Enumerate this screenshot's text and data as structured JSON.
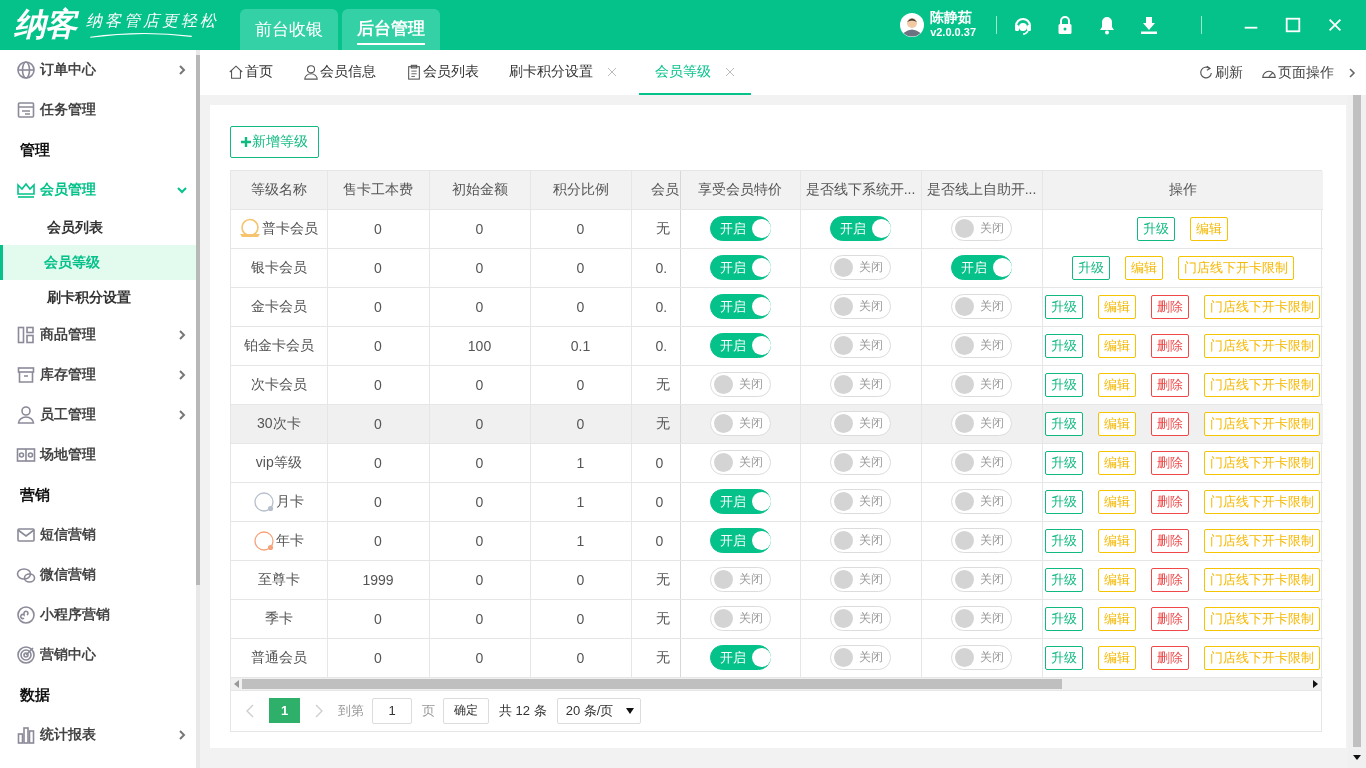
{
  "app": {
    "logo": "纳客",
    "slogan": "纳客管店更轻松",
    "modules": [
      {
        "label": "前台收银",
        "selected": false
      },
      {
        "label": "后台管理",
        "selected": true
      }
    ],
    "user": {
      "name": "陈静茹",
      "version": "v2.0.0.37"
    }
  },
  "sidebar": {
    "items": [
      {
        "kind": "menu",
        "label": "订单中心",
        "expandable": true,
        "expanded": false
      },
      {
        "kind": "menu",
        "label": "任务管理",
        "expandable": false,
        "expanded": false
      },
      {
        "kind": "section",
        "label": "管理"
      },
      {
        "kind": "menu",
        "label": "会员管理",
        "expandable": true,
        "expanded": true,
        "children": [
          {
            "label": "会员列表",
            "selected": false
          },
          {
            "label": "会员等级",
            "selected": true
          },
          {
            "label": "刷卡积分设置",
            "selected": false
          }
        ]
      },
      {
        "kind": "menu",
        "label": "商品管理",
        "expandable": true,
        "expanded": false
      },
      {
        "kind": "menu",
        "label": "库存管理",
        "expandable": true,
        "expanded": false
      },
      {
        "kind": "menu",
        "label": "员工管理",
        "expandable": true,
        "expanded": false
      },
      {
        "kind": "menu",
        "label": "场地管理",
        "expandable": false,
        "expanded": false
      },
      {
        "kind": "section",
        "label": "营销"
      },
      {
        "kind": "menu",
        "label": "短信营销",
        "expandable": false,
        "expanded": false
      },
      {
        "kind": "menu",
        "label": "微信营销",
        "expandable": false,
        "expanded": false
      },
      {
        "kind": "menu",
        "label": "小程序营销",
        "expandable": false,
        "expanded": false
      },
      {
        "kind": "menu",
        "label": "营销中心",
        "expandable": false,
        "expanded": false
      },
      {
        "kind": "section",
        "label": "数据"
      },
      {
        "kind": "menu",
        "label": "统计报表",
        "expandable": true,
        "expanded": false
      }
    ]
  },
  "tabs": [
    {
      "label": "首页",
      "selected": false,
      "closable": false
    },
    {
      "label": "会员信息",
      "selected": false,
      "closable": false
    },
    {
      "label": "会员列表",
      "selected": false,
      "closable": false
    },
    {
      "label": "刷卡积分设置",
      "selected": false,
      "closable": true
    },
    {
      "label": "会员等级",
      "selected": true,
      "closable": true
    }
  ],
  "tab_actions": [
    "刷新",
    "页面操作"
  ],
  "add_button": "新增等级",
  "table": {
    "columns": [
      "等级名称",
      "售卡工本费",
      "初始金额",
      "积分比例",
      "会员",
      "享受会员特价",
      "是否线下系统开...",
      "是否线上自助开...",
      "操作"
    ],
    "rows": [
      {
        "badge": {
          "kind": "medal",
          "color": "#f5c46c"
        },
        "cells": [
          "普卡会员",
          "0",
          "0",
          "0",
          "无"
        ],
        "highlighted": false,
        "toggles": [
          {
            "on": true,
            "label": "开启"
          },
          {
            "on": true,
            "label": "开启"
          },
          {
            "on": false,
            "label": "关闭"
          }
        ],
        "actions": [
          {
            "kind": "upgrade",
            "label": "升级"
          },
          {
            "kind": "edit",
            "label": "编辑"
          }
        ]
      },
      {
        "cells": [
          "银卡会员",
          "0",
          "0",
          "0",
          "0."
        ],
        "highlighted": false,
        "toggles": [
          {
            "on": true,
            "label": "开启"
          },
          {
            "on": false,
            "label": "关闭"
          },
          {
            "on": true,
            "label": "开启"
          }
        ],
        "actions": [
          {
            "kind": "upgrade",
            "label": "升级"
          },
          {
            "kind": "edit",
            "label": "编辑"
          },
          {
            "kind": "limit",
            "label": "门店线下开卡限制"
          }
        ]
      },
      {
        "cells": [
          "金卡会员",
          "0",
          "0",
          "0",
          "0."
        ],
        "highlighted": false,
        "toggles": [
          {
            "on": true,
            "label": "开启"
          },
          {
            "on": false,
            "label": "关闭"
          },
          {
            "on": false,
            "label": "关闭"
          }
        ],
        "actions": [
          {
            "kind": "upgrade",
            "label": "升级"
          },
          {
            "kind": "edit",
            "label": "编辑"
          },
          {
            "kind": "delete",
            "label": "删除"
          },
          {
            "kind": "limit",
            "label": "门店线下开卡限制"
          }
        ]
      },
      {
        "cells": [
          "铂金卡会员",
          "0",
          "100",
          "0.1",
          "0."
        ],
        "highlighted": false,
        "toggles": [
          {
            "on": true,
            "label": "开启"
          },
          {
            "on": false,
            "label": "关闭"
          },
          {
            "on": false,
            "label": "关闭"
          }
        ],
        "actions": [
          {
            "kind": "upgrade",
            "label": "升级"
          },
          {
            "kind": "edit",
            "label": "编辑"
          },
          {
            "kind": "delete",
            "label": "删除"
          },
          {
            "kind": "limit",
            "label": "门店线下开卡限制"
          }
        ]
      },
      {
        "cells": [
          "次卡会员",
          "0",
          "0",
          "0",
          "无"
        ],
        "highlighted": false,
        "toggles": [
          {
            "on": false,
            "label": "关闭"
          },
          {
            "on": false,
            "label": "关闭"
          },
          {
            "on": false,
            "label": "关闭"
          }
        ],
        "actions": [
          {
            "kind": "upgrade",
            "label": "升级"
          },
          {
            "kind": "edit",
            "label": "编辑"
          },
          {
            "kind": "delete",
            "label": "删除"
          },
          {
            "kind": "limit",
            "label": "门店线下开卡限制"
          }
        ]
      },
      {
        "cells": [
          "30次卡",
          "0",
          "0",
          "0",
          "无"
        ],
        "highlighted": true,
        "toggles": [
          {
            "on": false,
            "label": "关闭"
          },
          {
            "on": false,
            "label": "关闭"
          },
          {
            "on": false,
            "label": "关闭"
          }
        ],
        "actions": [
          {
            "kind": "upgrade",
            "label": "升级"
          },
          {
            "kind": "edit",
            "label": "编辑"
          },
          {
            "kind": "delete",
            "label": "删除"
          },
          {
            "kind": "limit",
            "label": "门店线下开卡限制"
          }
        ]
      },
      {
        "cells": [
          "vip等级",
          "0",
          "0",
          "1",
          "0"
        ],
        "highlighted": false,
        "toggles": [
          {
            "on": false,
            "label": "关闭"
          },
          {
            "on": false,
            "label": "关闭"
          },
          {
            "on": false,
            "label": "关闭"
          }
        ],
        "actions": [
          {
            "kind": "upgrade",
            "label": "升级"
          },
          {
            "kind": "edit",
            "label": "编辑"
          },
          {
            "kind": "delete",
            "label": "删除"
          },
          {
            "kind": "limit",
            "label": "门店线下开卡限制"
          }
        ]
      },
      {
        "badge": {
          "kind": "ring",
          "color": "#b8bfcc"
        },
        "cells": [
          "月卡",
          "0",
          "0",
          "1",
          "0"
        ],
        "highlighted": false,
        "toggles": [
          {
            "on": true,
            "label": "开启"
          },
          {
            "on": false,
            "label": "关闭"
          },
          {
            "on": false,
            "label": "关闭"
          }
        ],
        "actions": [
          {
            "kind": "upgrade",
            "label": "升级"
          },
          {
            "kind": "edit",
            "label": "编辑"
          },
          {
            "kind": "delete",
            "label": "删除"
          },
          {
            "kind": "limit",
            "label": "门店线下开卡限制"
          }
        ]
      },
      {
        "badge": {
          "kind": "ring",
          "color": "#f6a47c"
        },
        "cells": [
          "年卡",
          "0",
          "0",
          "1",
          "0"
        ],
        "highlighted": false,
        "toggles": [
          {
            "on": true,
            "label": "开启"
          },
          {
            "on": false,
            "label": "关闭"
          },
          {
            "on": false,
            "label": "关闭"
          }
        ],
        "actions": [
          {
            "kind": "upgrade",
            "label": "升级"
          },
          {
            "kind": "edit",
            "label": "编辑"
          },
          {
            "kind": "delete",
            "label": "删除"
          },
          {
            "kind": "limit",
            "label": "门店线下开卡限制"
          }
        ]
      },
      {
        "cells": [
          "至尊卡",
          "1999",
          "0",
          "0",
          "无"
        ],
        "highlighted": false,
        "toggles": [
          {
            "on": false,
            "label": "关闭"
          },
          {
            "on": false,
            "label": "关闭"
          },
          {
            "on": false,
            "label": "关闭"
          }
        ],
        "actions": [
          {
            "kind": "upgrade",
            "label": "升级"
          },
          {
            "kind": "edit",
            "label": "编辑"
          },
          {
            "kind": "delete",
            "label": "删除"
          },
          {
            "kind": "limit",
            "label": "门店线下开卡限制"
          }
        ]
      },
      {
        "cells": [
          "季卡",
          "0",
          "0",
          "0",
          "无"
        ],
        "highlighted": false,
        "toggles": [
          {
            "on": false,
            "label": "关闭"
          },
          {
            "on": false,
            "label": "关闭"
          },
          {
            "on": false,
            "label": "关闭"
          }
        ],
        "actions": [
          {
            "kind": "upgrade",
            "label": "升级"
          },
          {
            "kind": "edit",
            "label": "编辑"
          },
          {
            "kind": "delete",
            "label": "删除"
          },
          {
            "kind": "limit",
            "label": "门店线下开卡限制"
          }
        ]
      },
      {
        "cells": [
          "普通会员",
          "0",
          "0",
          "0",
          "无"
        ],
        "highlighted": false,
        "toggles": [
          {
            "on": true,
            "label": "开启"
          },
          {
            "on": false,
            "label": "关闭"
          },
          {
            "on": false,
            "label": "关闭"
          }
        ],
        "actions": [
          {
            "kind": "upgrade",
            "label": "升级"
          },
          {
            "kind": "edit",
            "label": "编辑"
          },
          {
            "kind": "delete",
            "label": "删除"
          },
          {
            "kind": "limit",
            "label": "门店线下开卡限制"
          }
        ]
      }
    ]
  },
  "pagination": {
    "pages": [
      {
        "label": "1",
        "selected": true
      }
    ],
    "goto_label": "到第",
    "goto_value": "1",
    "page_unit": "页",
    "confirm": "确定",
    "total": "共 12 条",
    "page_size": "20 条/页"
  }
}
